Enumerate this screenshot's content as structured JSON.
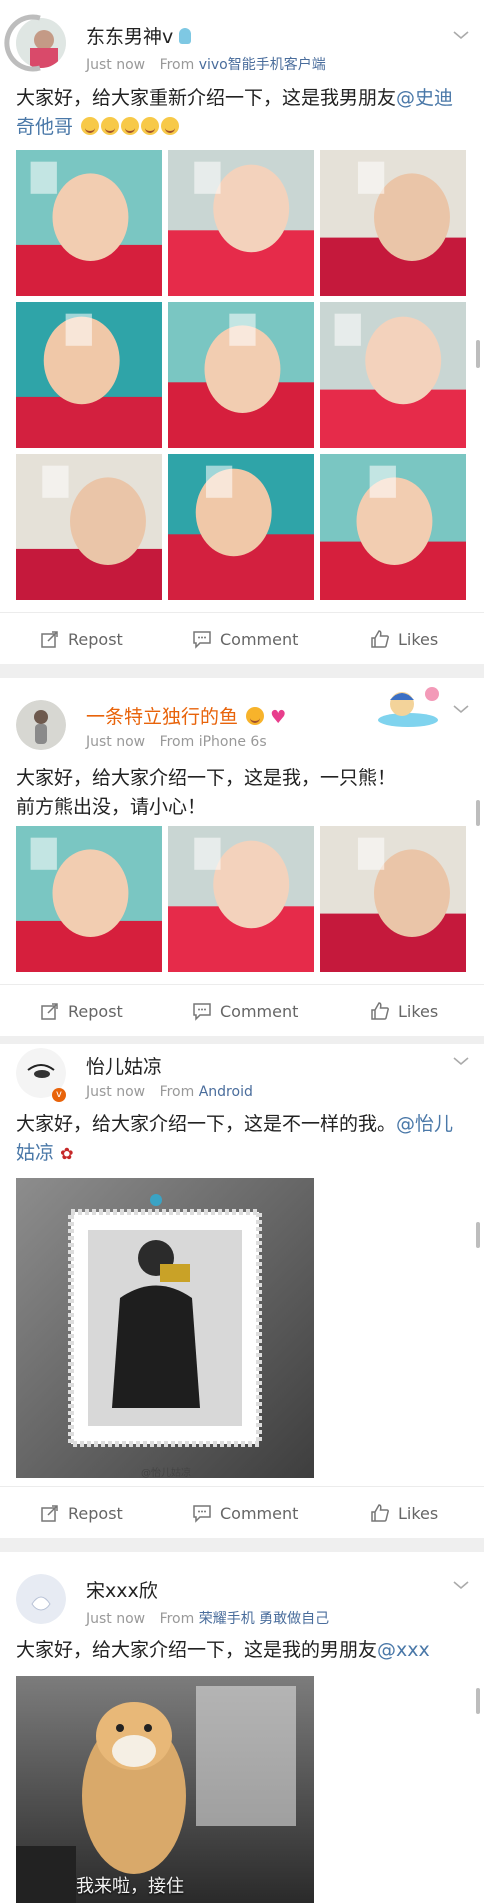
{
  "posts": [
    {
      "username": "东东男神v",
      "time": "Just now",
      "from_label": "From",
      "source": "vivo智能手机客户端",
      "text": "大家好，给大家重新介绍一下，这是我男朋友",
      "mention": "@史迪奇他哥",
      "emoji_count": 5,
      "image_count": 9
    },
    {
      "username": "一条特立独行的鱼",
      "time": "Just now",
      "from_label": "From",
      "source": "iPhone 6s",
      "text_line1": "大家好，给大家介绍一下，这是我，一只熊！",
      "text_line2": "前方熊出没，请小心！",
      "image_count": 3
    },
    {
      "username": "怡儿姑凉",
      "time": "Just now",
      "from_label": "From",
      "source": "Android",
      "text": "大家好，给大家介绍一下，这是不一样的我。",
      "mention": "@怡儿姑凉",
      "watermark": "@怡儿姑凉"
    },
    {
      "username": "宋xxx欣",
      "time": "Just now",
      "from_label": "From",
      "source": "荣耀手机 勇敢做自己",
      "text": "大家好，给大家介绍一下，这是我的男朋友",
      "mention": "@xxx",
      "caption": "我来啦，接住"
    }
  ],
  "actions": {
    "repost": "Repost",
    "comment": "Comment",
    "likes": "Likes"
  },
  "colors": {
    "mention": "#4a78a8",
    "source": "#4a6d9c",
    "orange_name": "#e8630a",
    "separator": "#efefef"
  },
  "icons": [
    "chevron-down-icon",
    "repost-icon",
    "comment-icon",
    "like-icon",
    "verified-badge-icon",
    "emoji-icon",
    "heart-icon"
  ]
}
